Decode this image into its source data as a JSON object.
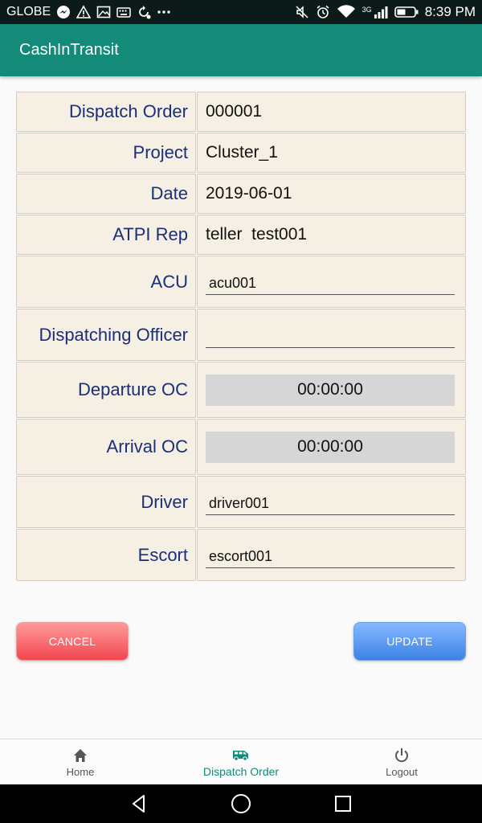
{
  "status_bar": {
    "carrier": "GLOBE",
    "time": "8:39 PM",
    "network": "3G",
    "left_icons": [
      "messenger-icon",
      "alert-icon",
      "image-icon",
      "keyboard-icon",
      "sync-icon",
      "more-icon"
    ],
    "right_icons": [
      "mute-icon",
      "alarm-icon",
      "wifi-icon",
      "signal-icon",
      "battery-icon"
    ]
  },
  "app_bar": {
    "title": "CashInTransit"
  },
  "form": {
    "dispatch_order": {
      "label": "Dispatch Order",
      "value": "000001"
    },
    "project": {
      "label": "Project",
      "value": "Cluster_1"
    },
    "date": {
      "label": "Date",
      "value": "2019-06-01"
    },
    "atpi_rep": {
      "label": "ATPI Rep",
      "value": "teller  test001"
    },
    "acu": {
      "label": "ACU",
      "value": "acu001"
    },
    "dispatching_officer": {
      "label": "Dispatching Officer",
      "value": ""
    },
    "departure_oc": {
      "label": "Departure OC",
      "value": "00:00:00"
    },
    "arrival_oc": {
      "label": "Arrival OC",
      "value": "00:00:00"
    },
    "driver": {
      "label": "Driver",
      "value": "driver001"
    },
    "escort": {
      "label": "Escort",
      "value": "escort001"
    }
  },
  "buttons": {
    "cancel": "CANCEL",
    "update": "UPDATE"
  },
  "bottom_nav": {
    "home": "Home",
    "dispatch_order": "Dispatch Order",
    "logout": "Logout",
    "active": "dispatch_order"
  },
  "colors": {
    "primary": "#148a79",
    "label_text": "#1b2e7a",
    "cell_bg": "#f5f0e3",
    "cancel": "#f2464f",
    "update": "#3c82e6"
  }
}
